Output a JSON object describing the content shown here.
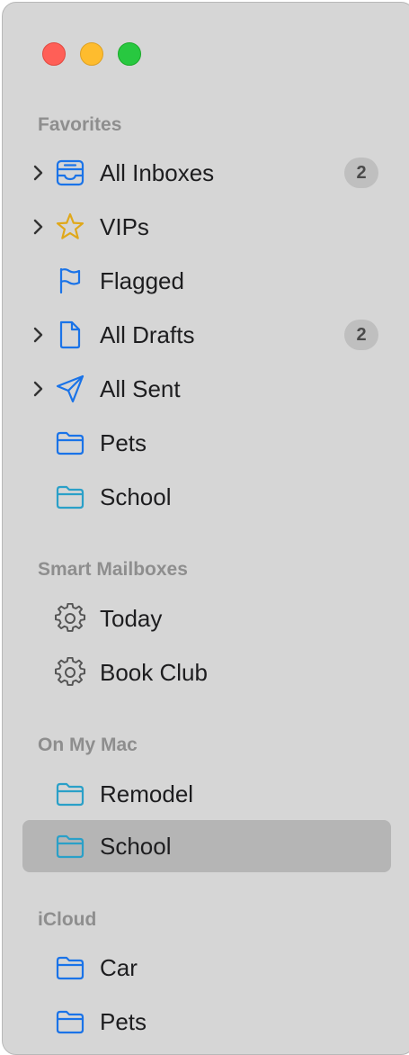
{
  "window": {
    "traffic_lights": [
      "close",
      "minimize",
      "zoom"
    ]
  },
  "colors": {
    "sidebar_bg": "#d6d6d6",
    "selected_row": "#b5b5b5",
    "accent_blue": "#1a73e8",
    "folder_teal": "#2aa0c8",
    "vip_star": "#e0a81a",
    "section_header": "#8e8e8e"
  },
  "sections": {
    "favorites": {
      "title": "Favorites",
      "items": [
        {
          "label": "All Inboxes",
          "icon": "inbox-tray-icon",
          "badge": "2",
          "disclosure": true
        },
        {
          "label": "VIPs",
          "icon": "star-icon",
          "disclosure": true
        },
        {
          "label": "Flagged",
          "icon": "flag-icon"
        },
        {
          "label": "All Drafts",
          "icon": "document-icon",
          "badge": "2",
          "disclosure": true
        },
        {
          "label": "All Sent",
          "icon": "paper-plane-icon",
          "disclosure": true
        },
        {
          "label": "Pets",
          "icon": "folder-icon"
        },
        {
          "label": "School",
          "icon": "folder-icon"
        }
      ]
    },
    "smart": {
      "title": "Smart Mailboxes",
      "items": [
        {
          "label": "Today",
          "icon": "gear-icon"
        },
        {
          "label": "Book Club",
          "icon": "gear-icon"
        }
      ]
    },
    "onmymac": {
      "title": "On My Mac",
      "items": [
        {
          "label": "Remodel",
          "icon": "folder-icon"
        },
        {
          "label": "School",
          "icon": "folder-icon",
          "selected": true
        }
      ]
    },
    "icloud": {
      "title": "iCloud",
      "items": [
        {
          "label": "Car",
          "icon": "folder-icon"
        },
        {
          "label": "Pets",
          "icon": "folder-icon"
        }
      ]
    }
  }
}
